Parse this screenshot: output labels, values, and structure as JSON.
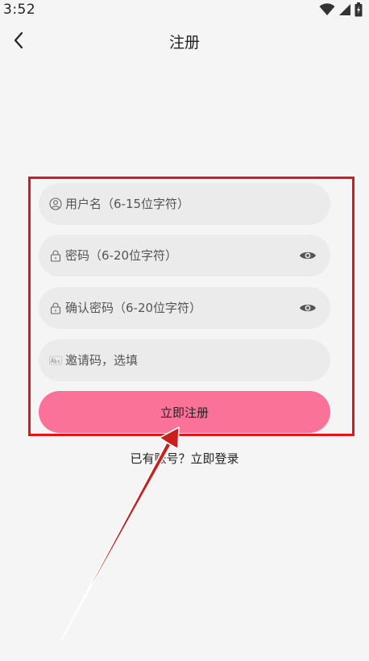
{
  "status_bar": {
    "time": "3:52"
  },
  "header": {
    "title": "注册",
    "back_icon": "chevron-left-icon"
  },
  "form": {
    "username": {
      "placeholder": "用户名（6-15位字符）",
      "value": "",
      "icon": "user-circle-icon"
    },
    "password": {
      "placeholder": "密码（6-20位字符）",
      "value": "",
      "icon": "lock-icon",
      "toggle_icon": "eye-icon"
    },
    "confirm_password": {
      "placeholder": "确认密码（6-20位字符）",
      "value": "",
      "icon": "lock-icon",
      "toggle_icon": "eye-icon"
    },
    "invite_code": {
      "placeholder": "邀请码，选填",
      "value": "",
      "icon": "abc-icon"
    },
    "submit_label": "立即注册"
  },
  "footer": {
    "login_prompt": "已有账号？立即登录"
  },
  "colors": {
    "background": "#f5f5f5",
    "field_background": "#ebebeb",
    "button": "#fb7299",
    "annotation": "#e0161f"
  }
}
